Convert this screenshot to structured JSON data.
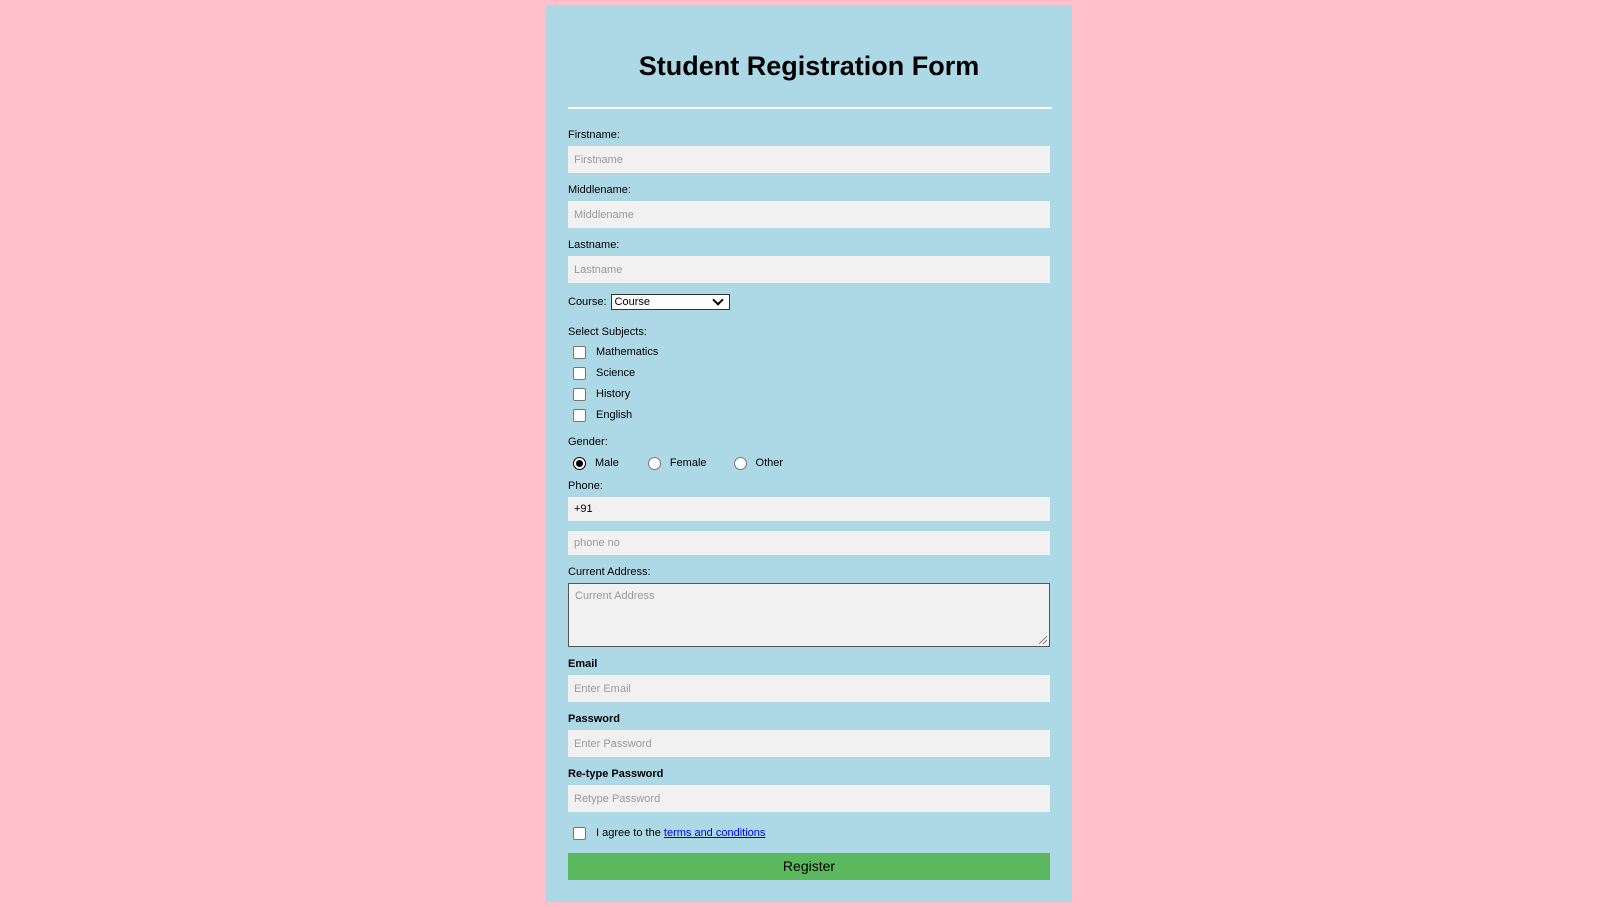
{
  "form": {
    "title": "Student Registration Form",
    "firstname": {
      "label": "Firstname:",
      "placeholder": "Firstname"
    },
    "middlename": {
      "label": "Middlename:",
      "placeholder": "Middlename"
    },
    "lastname": {
      "label": "Lastname:",
      "placeholder": "Lastname"
    },
    "course": {
      "label": "Course:",
      "selected": "Course"
    },
    "subjects": {
      "label": "Select Subjects:",
      "items": [
        {
          "label": "Mathematics",
          "checked": false
        },
        {
          "label": "Science",
          "checked": false
        },
        {
          "label": "History",
          "checked": false
        },
        {
          "label": "English",
          "checked": false
        }
      ]
    },
    "gender": {
      "label": "Gender:",
      "options": [
        {
          "label": "Male",
          "selected": true
        },
        {
          "label": "Female",
          "selected": false
        },
        {
          "label": "Other",
          "selected": false
        }
      ]
    },
    "phone": {
      "label": "Phone:",
      "code_value": "+91",
      "number_placeholder": "phone no"
    },
    "address": {
      "label": "Current Address:",
      "placeholder": "Current Address"
    },
    "email": {
      "label": "Email",
      "placeholder": "Enter Email"
    },
    "password": {
      "label": "Password",
      "placeholder": "Enter Password"
    },
    "retype_password": {
      "label": "Re-type Password",
      "placeholder": "Retype Password"
    },
    "terms": {
      "prefix": "I agree to the ",
      "link": "terms and conditions",
      "checked": false
    },
    "register_label": "Register"
  },
  "colors": {
    "page_background": "#ffc0cb",
    "panel_background": "#add8e6",
    "register_button": "#5cb85c",
    "input_background": "#f1f1f1"
  }
}
